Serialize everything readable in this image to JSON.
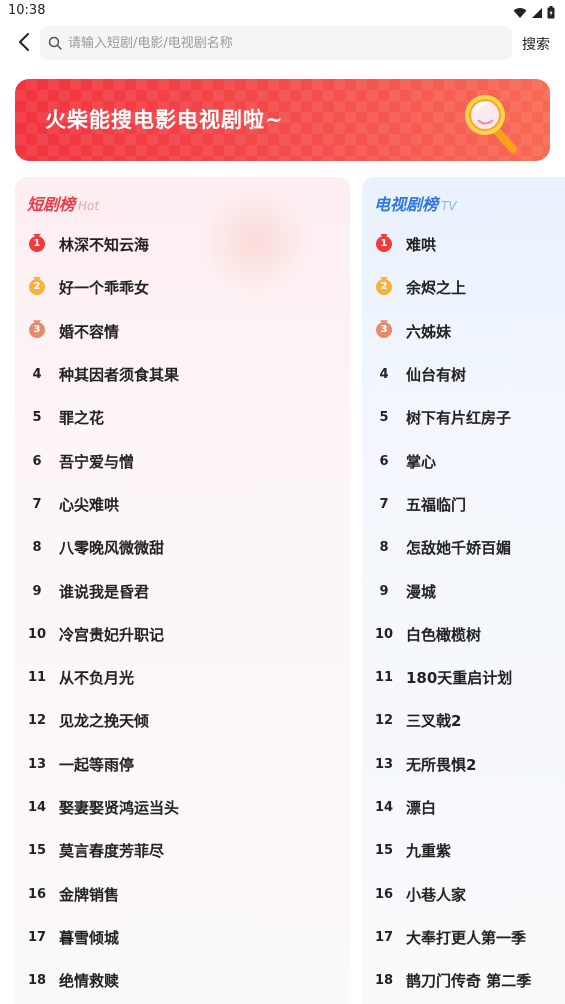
{
  "status": {
    "time": "10:38"
  },
  "search": {
    "placeholder": "请输入短剧/电影/电视剧名称",
    "button_label": "搜索"
  },
  "banner": {
    "text": "火柴能搜电影电视剧啦~"
  },
  "short_drama": {
    "title": "短剧榜",
    "subtitle": "Hot",
    "accent_color": "#ef3a4b",
    "items": [
      {
        "rank": "1",
        "title": "林深不知云海"
      },
      {
        "rank": "2",
        "title": "好一个乖乖女"
      },
      {
        "rank": "3",
        "title": "婚不容情"
      },
      {
        "rank": "4",
        "title": "种其因者须食其果"
      },
      {
        "rank": "5",
        "title": "罪之花"
      },
      {
        "rank": "6",
        "title": "吾宁爱与憎"
      },
      {
        "rank": "7",
        "title": "心尖难哄"
      },
      {
        "rank": "8",
        "title": "八零晚风微微甜"
      },
      {
        "rank": "9",
        "title": "谁说我是昏君"
      },
      {
        "rank": "10",
        "title": "冷宫贵妃升职记"
      },
      {
        "rank": "11",
        "title": "从不负月光"
      },
      {
        "rank": "12",
        "title": "见龙之挽天倾"
      },
      {
        "rank": "13",
        "title": "一起等雨停"
      },
      {
        "rank": "14",
        "title": "娶妻娶贤鸿运当头"
      },
      {
        "rank": "15",
        "title": "莫言春度芳菲尽"
      },
      {
        "rank": "16",
        "title": "金牌销售"
      },
      {
        "rank": "17",
        "title": "暮雪倾城"
      },
      {
        "rank": "18",
        "title": "绝情救赎"
      }
    ]
  },
  "tv_drama": {
    "title": "电视剧榜",
    "subtitle": "TV",
    "accent_color": "#2f76e8",
    "items": [
      {
        "rank": "1",
        "title": "难哄"
      },
      {
        "rank": "2",
        "title": "余烬之上"
      },
      {
        "rank": "3",
        "title": "六姊妹"
      },
      {
        "rank": "4",
        "title": "仙台有树"
      },
      {
        "rank": "5",
        "title": "树下有片红房子"
      },
      {
        "rank": "6",
        "title": "掌心"
      },
      {
        "rank": "7",
        "title": "五福临门"
      },
      {
        "rank": "8",
        "title": "怎敌她千娇百媚"
      },
      {
        "rank": "9",
        "title": "漫城"
      },
      {
        "rank": "10",
        "title": "白色橄榄树"
      },
      {
        "rank": "11",
        "title": "180天重启计划"
      },
      {
        "rank": "12",
        "title": "三叉戟2"
      },
      {
        "rank": "13",
        "title": "无所畏惧2"
      },
      {
        "rank": "14",
        "title": "漂白"
      },
      {
        "rank": "15",
        "title": "九重紫"
      },
      {
        "rank": "16",
        "title": "小巷人家"
      },
      {
        "rank": "17",
        "title": "大奉打更人第一季"
      },
      {
        "rank": "18",
        "title": "鹊刀门传奇 第二季"
      }
    ]
  },
  "medal_colors": {
    "gold_red": "#ef3b3b",
    "silver_orange": "#f6b23a",
    "bronze": "#e58c6b"
  },
  "icons": {
    "back": "chevron-left-icon",
    "search": "search-icon",
    "wifi": "wifi-icon",
    "signal": "signal-icon",
    "battery": "battery-icon",
    "banner": "magnifier-icon"
  }
}
